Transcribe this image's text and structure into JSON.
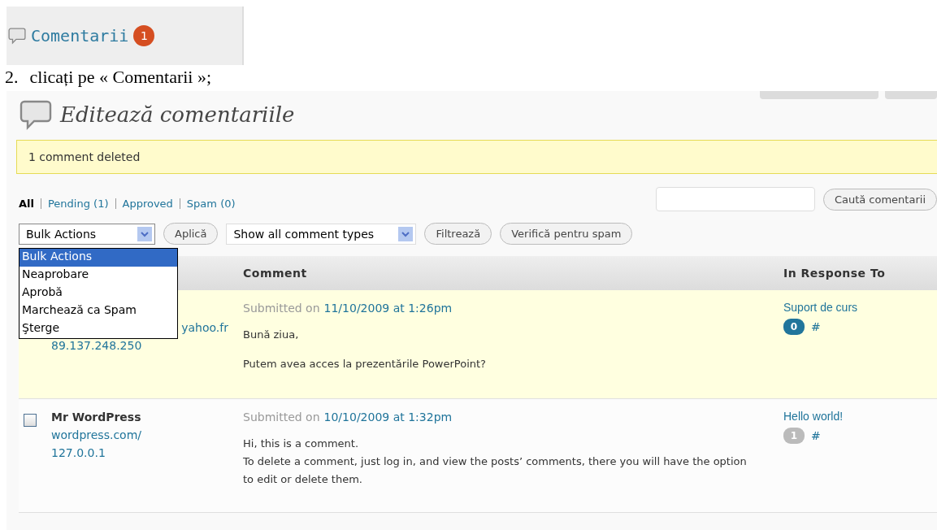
{
  "menu_snippet": {
    "label": "Comentarii",
    "badge": "1"
  },
  "instruction": {
    "number": "2.",
    "text": "clicați pe « Comentarii »;"
  },
  "screen": {
    "title": "Editează comentariile",
    "notice": "1 comment deleted",
    "views": [
      {
        "label": "All",
        "selected": true
      },
      {
        "label": "Pending (1)",
        "selected": false
      },
      {
        "label": "Approved",
        "selected": false
      },
      {
        "label": "Spam (0)",
        "selected": false
      }
    ],
    "search": {
      "button": "Caută comentarii"
    },
    "bulk_select": {
      "value": "Bulk Actions",
      "expanded": true,
      "options": [
        {
          "label": "Bulk Actions",
          "selected": true
        },
        {
          "label": "Neaprobare",
          "selected": false
        },
        {
          "label": "Aprobă",
          "selected": false
        },
        {
          "label": "Marchează ca Spam",
          "selected": false
        },
        {
          "label": "Şterge",
          "selected": false
        }
      ]
    },
    "apply_button": "Aplică",
    "type_select": {
      "value": "Show all comment types"
    },
    "filter_button": "Filtrează",
    "spam_button": "Verifică pentru spam",
    "table": {
      "columns": [
        "Comment",
        "In Response To"
      ],
      "rows": [
        {
          "highlighted": true,
          "author_links": [
            "yahoo.fr",
            "89.137.248.250"
          ],
          "submitted_prefix": "Submitted on",
          "submitted_date": "11/10/2009 at 1:26pm",
          "paragraphs": [
            [
              "Bună ziua,"
            ],
            [
              "Putem avea acces la prezentările PowerPoint?"
            ]
          ],
          "post": "Suport de curs",
          "count": "0",
          "pending": true,
          "hash": "#"
        },
        {
          "highlighted": false,
          "checked": false,
          "author": "Mr WordPress",
          "author_links": [
            "wordpress.com/",
            "127.0.0.1"
          ],
          "submitted_prefix": "Submitted on",
          "submitted_date": "10/10/2009 at 1:32pm",
          "paragraphs": [
            [
              "Hi, this is a comment.",
              "To delete a comment, just log in, and view the posts’ comments, there you will have the option to edit or delete them."
            ]
          ],
          "post": "Hello world!",
          "count": "1",
          "pending": false,
          "hash": "#"
        }
      ]
    }
  }
}
